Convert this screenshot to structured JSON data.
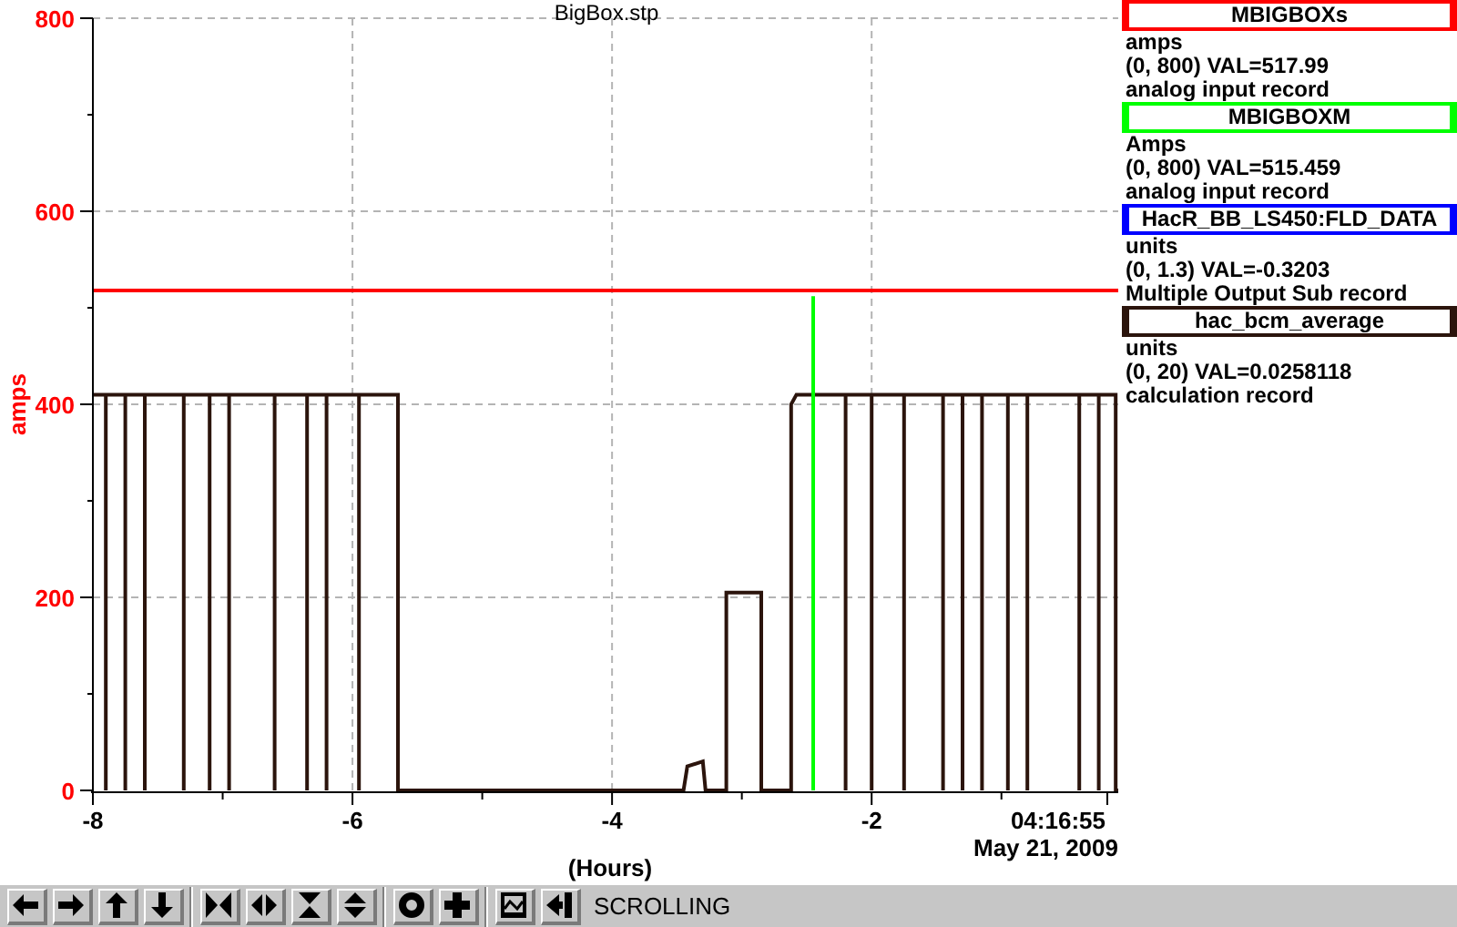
{
  "chart_panel": {
    "chart_data": {
      "type": "line",
      "grid": true,
      "title": "BigBox.stp",
      "xlabel": "(Hours)",
      "ylabel": "amps",
      "xlim": [
        -8,
        -0.1
      ],
      "ylim": [
        0,
        800
      ],
      "xticks": [
        -8,
        -6,
        -4,
        -2
      ],
      "yticks": [
        0,
        200,
        400,
        600,
        800
      ],
      "x": [
        -8,
        -7.9,
        -7.9,
        -7.9,
        -7.75,
        -7.75,
        -7.75,
        -7.6,
        -7.6,
        -7.6,
        -7.3,
        -7.3,
        -7.3,
        -7.1,
        -7.1,
        -7.1,
        -6.95,
        -6.95,
        -6.95,
        -6.6,
        -6.6,
        -6.6,
        -6.35,
        -6.35,
        -6.35,
        -6.2,
        -6.2,
        -6.2,
        -5.95,
        -5.95,
        -5.95,
        -5.65,
        -5.65,
        -3.45,
        -3.42,
        -3.3,
        -3.28,
        -3.12,
        -3.12,
        -2.85,
        -2.85,
        -2.62,
        -2.62,
        -2.58,
        -2.45,
        -2.45,
        -2.45,
        -2.2,
        -2.2,
        -2.2,
        -2,
        -2,
        -2,
        -1.75,
        -1.75,
        -1.75,
        -1.45,
        -1.45,
        -1.45,
        -1.3,
        -1.3,
        -1.3,
        -1.15,
        -1.15,
        -1.15,
        -0.95,
        -0.95,
        -0.95,
        -0.8,
        -0.8,
        -0.8,
        -0.4,
        -0.4,
        -0.4,
        -0.25,
        -0.25,
        -0.25,
        -0.12,
        -0.12,
        -0.1
      ],
      "series": [
        {
          "color": "#ff0000",
          "values": [
            518,
            518,
            518,
            518,
            518,
            518,
            518,
            518,
            518,
            518,
            518,
            518,
            518,
            518,
            518,
            518,
            518,
            518,
            518,
            518,
            518,
            518,
            518,
            518,
            518,
            518,
            518,
            518,
            518,
            518,
            518,
            518,
            518,
            518,
            518,
            518,
            518,
            518,
            518,
            518,
            518,
            518,
            518,
            518,
            518,
            518,
            518,
            518,
            518,
            518,
            518,
            518,
            518,
            518,
            518,
            518,
            518,
            518,
            518,
            518,
            518,
            518,
            518,
            518,
            518,
            518,
            518,
            518,
            518,
            518,
            518,
            518,
            518,
            518,
            518,
            518,
            518,
            518,
            518,
            518
          ]
        },
        {
          "color": "#00ff00",
          "values": [
            null,
            null,
            null,
            null,
            null,
            null,
            null,
            null,
            null,
            null,
            null,
            null,
            null,
            null,
            null,
            null,
            null,
            null,
            null,
            null,
            null,
            null,
            null,
            null,
            null,
            null,
            null,
            null,
            null,
            null,
            null,
            null,
            null,
            null,
            null,
            null,
            null,
            null,
            null,
            null,
            null,
            null,
            null,
            null,
            512,
            0,
            null,
            null,
            null,
            null,
            null,
            null,
            null,
            null,
            null,
            null,
            null,
            null,
            null,
            null,
            null,
            null,
            null,
            null,
            null,
            null,
            null,
            null,
            null,
            null,
            null,
            null,
            null,
            null,
            null,
            null,
            null,
            null,
            null,
            null
          ]
        },
        {
          "color": "#2b140c",
          "values": [
            410,
            410,
            0,
            410,
            410,
            0,
            410,
            410,
            0,
            410,
            410,
            0,
            410,
            410,
            0,
            410,
            410,
            0,
            410,
            410,
            0,
            410,
            410,
            0,
            410,
            410,
            0,
            410,
            410,
            0,
            410,
            410,
            0,
            0,
            25,
            30,
            0,
            0,
            205,
            205,
            0,
            0,
            400,
            410,
            410,
            410,
            410,
            410,
            0,
            410,
            410,
            0,
            410,
            410,
            0,
            410,
            410,
            0,
            410,
            410,
            0,
            410,
            410,
            0,
            410,
            410,
            0,
            410,
            410,
            0,
            410,
            410,
            0,
            410,
            410,
            0,
            410,
            410,
            0,
            0
          ]
        }
      ]
    },
    "end_time": "04:16:55",
    "end_date": "May 21, 2009"
  },
  "legend": {
    "traces": [
      {
        "name": "MBIGBOXs",
        "color": "#ff0000",
        "units": "amps",
        "range_value": "(0, 800) VAL=517.99",
        "record_type": "analog input record"
      },
      {
        "name": "MBIGBOXM",
        "color": "#00ff00",
        "units": "Amps",
        "range_value": "(0, 800) VAL=515.459",
        "record_type": "analog input record"
      },
      {
        "name": "HacR_BB_LS450:FLD_DATA",
        "color": "#0000ff",
        "units": "units",
        "range_value": "(0, 1.3) VAL=-0.3203",
        "record_type": "Multiple Output Sub record"
      },
      {
        "name": "hac_bcm_average",
        "color": "#2b140c",
        "units": "units",
        "range_value": "(0, 20) VAL=0.0258118",
        "record_type": "calculation record"
      }
    ]
  },
  "toolbar": {
    "groups": [
      [
        {
          "kind": "left"
        },
        {
          "kind": "right"
        },
        {
          "kind": "up"
        },
        {
          "kind": "down"
        }
      ],
      [
        {
          "kind": "hcompress"
        },
        {
          "kind": "hexpand"
        },
        {
          "kind": "vcompress"
        },
        {
          "kind": "vexpand"
        }
      ],
      [
        {
          "kind": "ring"
        },
        {
          "kind": "plus"
        }
      ],
      [
        {
          "kind": "graph"
        },
        {
          "kind": "tobar"
        }
      ]
    ],
    "mode": "SCROLLING"
  }
}
